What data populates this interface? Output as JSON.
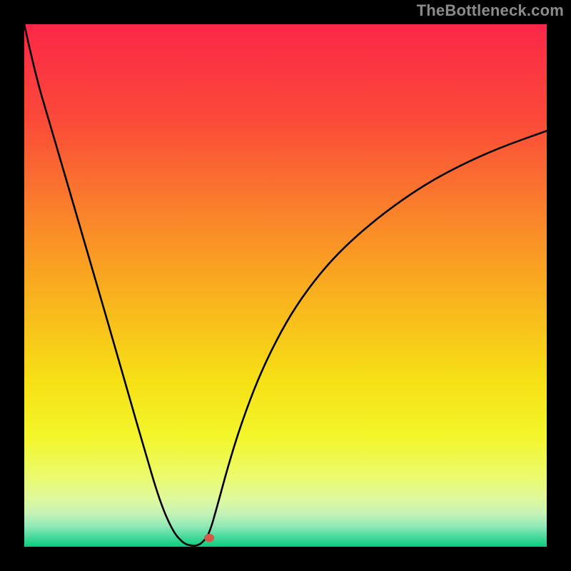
{
  "watermark_text": "TheBottleneck.com",
  "chart_data": {
    "type": "line",
    "title": "",
    "xlabel": "",
    "ylabel": "",
    "xlim": [
      0,
      100
    ],
    "ylim": [
      0,
      100
    ],
    "grid": false,
    "legend": false,
    "background_gradient_stops": [
      {
        "offset": 0.0,
        "color": "#fb2748"
      },
      {
        "offset": 0.18,
        "color": "#fb4939"
      },
      {
        "offset": 0.36,
        "color": "#fa822b"
      },
      {
        "offset": 0.52,
        "color": "#f9b21e"
      },
      {
        "offset": 0.68,
        "color": "#f6e015"
      },
      {
        "offset": 0.79,
        "color": "#f3f62b"
      },
      {
        "offset": 0.86,
        "color": "#ecfa67"
      },
      {
        "offset": 0.905,
        "color": "#e0f999"
      },
      {
        "offset": 0.935,
        "color": "#c8f3b6"
      },
      {
        "offset": 0.96,
        "color": "#93e9b8"
      },
      {
        "offset": 0.985,
        "color": "#3ad797"
      },
      {
        "offset": 1.0,
        "color": "#0acd7c"
      }
    ],
    "x": [
      0,
      2,
      5,
      8,
      11,
      14,
      17,
      20,
      23,
      26,
      28.5,
      30.5,
      32,
      33,
      34,
      35.4,
      37,
      39,
      41.5,
      45,
      49,
      53,
      58,
      63,
      69,
      76,
      83,
      91,
      100
    ],
    "series": [
      {
        "name": "bottleneck-curve",
        "values": [
          100,
          90.8,
          80.6,
          70.4,
          60.1,
          49.8,
          39.5,
          29.0,
          18.6,
          8.5,
          2.8,
          0.6,
          0.2,
          0.2,
          0.7,
          2.4,
          8.0,
          15.4,
          23.5,
          32.8,
          41.0,
          47.6,
          54.0,
          59.0,
          64.0,
          68.9,
          72.8,
          76.4,
          79.6
        ]
      }
    ],
    "marker": {
      "x": 35.4,
      "y": 1.7,
      "color": "#d25a4a",
      "radius": 7
    },
    "curve_style": {
      "stroke": "#000000",
      "stroke_width": 2.6
    }
  }
}
